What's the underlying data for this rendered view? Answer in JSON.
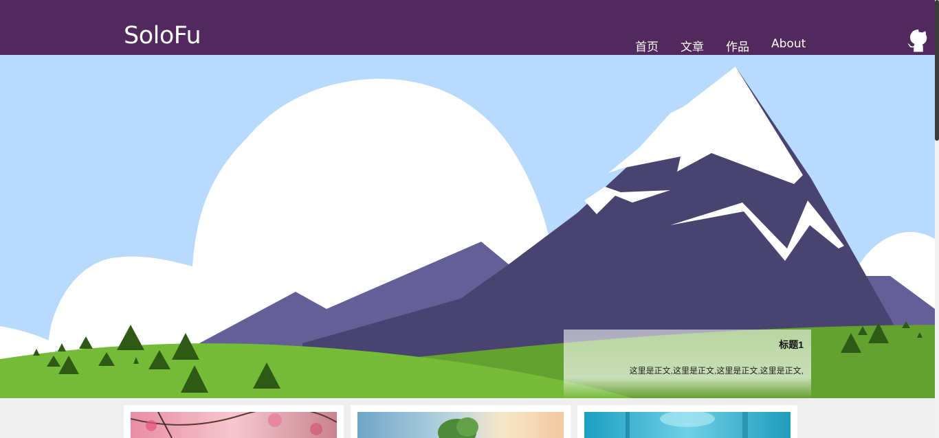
{
  "site": {
    "logo": "SoloFu"
  },
  "nav": {
    "items": [
      {
        "label": "首页"
      },
      {
        "label": "文章"
      },
      {
        "label": "作品"
      },
      {
        "label": "About"
      }
    ]
  },
  "header": {
    "background": "#52295c",
    "github_icon": "github-octocat-icon"
  },
  "carousel": {
    "caption_title": "标题1",
    "caption_text": "这里是正文,这里是正文,这里是正文,这里是正文,"
  },
  "cards": [
    {
      "image": "pink-blossom-tree-image"
    },
    {
      "image": "tree-sunset-image"
    },
    {
      "image": "blue-forest-image"
    }
  ]
}
